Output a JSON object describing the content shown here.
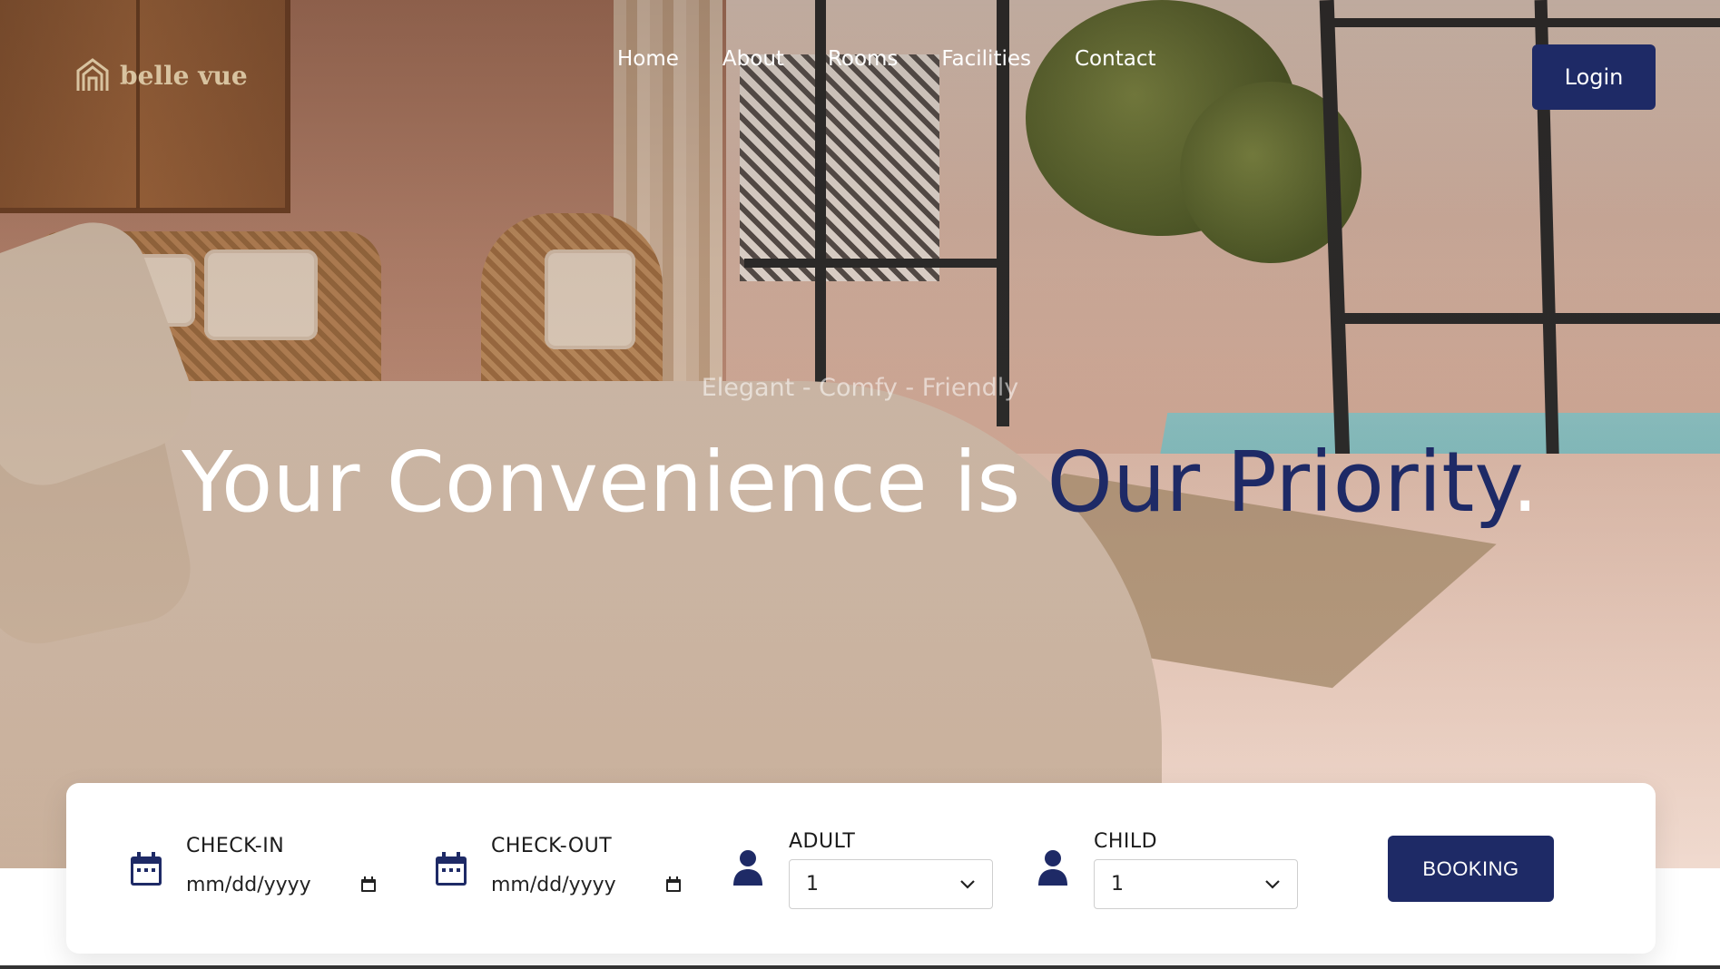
{
  "brand": {
    "name": "belle vue",
    "color": "#d8c3a0",
    "icon": "house-logo-icon"
  },
  "nav": {
    "items": [
      {
        "label": "Home"
      },
      {
        "label": "About"
      },
      {
        "label": "Rooms"
      },
      {
        "label": "Facilities"
      },
      {
        "label": "Contact"
      }
    ],
    "login_label": "Login"
  },
  "hero": {
    "tagline": "Elegant - Comfy - Friendly",
    "headline_part1": "Your Convenience is ",
    "headline_accent": "Our Priority",
    "headline_end": "."
  },
  "booking": {
    "check_in": {
      "label": "CHECK-IN",
      "placeholder": "mm/dd/yyyy",
      "icon": "calendar-icon"
    },
    "check_out": {
      "label": "CHECK-OUT",
      "placeholder": "mm/dd/yyyy",
      "icon": "calendar-icon"
    },
    "adult": {
      "label": "ADULT",
      "value": "1",
      "icon": "person-icon"
    },
    "child": {
      "label": "CHILD",
      "value": "1",
      "icon": "person-icon"
    },
    "button_label": "BOOKING"
  },
  "colors": {
    "accent": "#1e2a66",
    "white": "#ffffff"
  }
}
